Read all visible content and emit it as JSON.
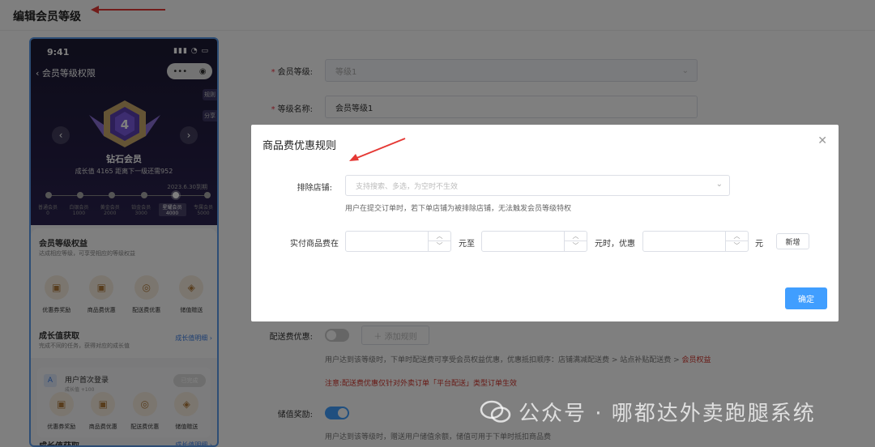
{
  "page": {
    "title": "编辑会员等级"
  },
  "phone": {
    "status_time": "9:41",
    "nav_title": "会员等级权限",
    "capsule_dots": "•••",
    "capsule_target": "◉",
    "side_rule": "规则",
    "side_share": "分享",
    "level_badge_number": "4",
    "level_name": "钻石会员",
    "growth_text": "成长值 4165 距离下一级还需952",
    "expire_text": "2023.6.30到期",
    "levels": [
      {
        "name": "普通会员",
        "value": "0"
      },
      {
        "name": "白银会员",
        "value": "1000"
      },
      {
        "name": "黄金会员",
        "value": "2000"
      },
      {
        "name": "铂金会员",
        "value": "3000"
      },
      {
        "name": "星耀会员",
        "value": "4000"
      },
      {
        "name": "专属会员",
        "value": "5000"
      }
    ],
    "benefits_title": "会员等级权益",
    "benefits_sub": "达成相应等级，可享受相应的等级权益",
    "benefits": [
      {
        "label": "优惠券奖励"
      },
      {
        "label": "商品费优惠"
      },
      {
        "label": "配送费优惠"
      },
      {
        "label": "储值赠送"
      }
    ],
    "growth_title": "成长值获取",
    "growth_sub": "完成不同的任务，获得对应的成长值",
    "growth_link": "成长值明细 ›",
    "task_title": "用户首次登录",
    "task_sub": "成长值 +100",
    "task_status": "已完成",
    "bottom_title": "成长值获取",
    "bottom_link": "成长值明细 ›"
  },
  "form": {
    "level_label": "会员等级:",
    "level_value": "等级1",
    "name_label": "等级名称:",
    "name_value": "会员等级1",
    "delivery_label": "配送费优惠:",
    "add_rule": "＋ 添加规则",
    "delivery_help": "用户达到该等级时，下单时配送费可享受会员权益优惠，优惠抵扣顺序：店铺满减配送费 > 站点补贴配送费 >",
    "delivery_help_red": "会员权益",
    "delivery_warn": "注意:配送费优惠仅针对外卖订单「平台配送」类型订单生效",
    "stored_label": "储值奖励:",
    "stored_help": "用户达到该等级时，赠送用户储值余额，储值可用于下单时抵扣商品费"
  },
  "modal": {
    "title": "商品费优惠规则",
    "exclude_label": "排除店铺:",
    "exclude_placeholder": "支持搜索、多选，为空时不生效",
    "exclude_help": "用户在提交订单时，若下单店铺为被排除店铺，无法触发会员等级特权",
    "paid_label": "实付商品费在",
    "unit_to": "元至",
    "unit_when": "元时，优惠",
    "unit_yuan": "元",
    "add_button": "新增",
    "confirm_button": "确定"
  },
  "watermark": {
    "text": "公众号 · 哪都达外卖跑腿系统"
  },
  "colors": {
    "primary": "#409eff",
    "danger": "#d0342c",
    "annotation_arrow": "#e53935"
  }
}
